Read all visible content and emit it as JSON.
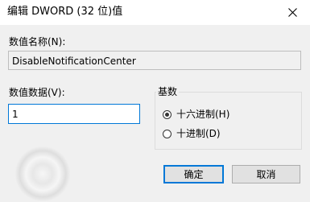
{
  "window": {
    "title": "编辑 DWORD (32 位)值",
    "close_glyph": "close-icon"
  },
  "value_name": {
    "label": "数值名称(N):",
    "value": "DisableNotificationCenter"
  },
  "value_data": {
    "label": "数值数据(V):",
    "value": "1"
  },
  "base": {
    "title": "基数",
    "options": [
      {
        "label": "十六进制(H)",
        "checked": true
      },
      {
        "label": "十进制(D)",
        "checked": false
      }
    ]
  },
  "buttons": {
    "ok_label": "确定",
    "cancel_label": "取消"
  },
  "colors": {
    "accent": "#0078d7",
    "client_bg": "#f0f0f0"
  }
}
